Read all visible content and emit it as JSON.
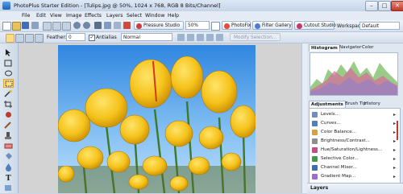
{
  "window": {
    "title": "PhotoPlus Starter Edition - [Tulips.jpg @ 50%, 1024 x 768, RGB 8 Bits/Channel]",
    "minimize": "–",
    "maximize": "□",
    "close": "✕"
  },
  "menu": [
    "File",
    "Edit",
    "View",
    "Image",
    "Effects",
    "Layers",
    "Select",
    "Window",
    "Help"
  ],
  "toolbar": {
    "pressure_studio": "Pressure Studio",
    "zoom_value": "50%",
    "photofix": "PhotoFix",
    "filter_gallery": "Filter Gallery",
    "cutout_studio": "Cutout Studio",
    "workspace_label": "Workspace",
    "workspace_value": "Default"
  },
  "context_toolbar": {
    "feather_label": "Feather:",
    "feather_value": "0",
    "antialias_label": "Antialias",
    "antialias_checked": "✓",
    "blend_value": "Normal",
    "modify_selection": "Modify Selection..."
  },
  "panels": {
    "top_tabs": [
      "Histogram",
      "Navigator",
      "Color"
    ],
    "mid_tabs": [
      "Adjustments",
      "Brush Tip",
      "History"
    ],
    "adjustments": [
      {
        "label": "Levels...",
        "color": "#6b8fbf"
      },
      {
        "label": "Curves...",
        "color": "#4d7fc1"
      },
      {
        "label": "Color Balance...",
        "color": "#d9a13b"
      },
      {
        "label": "Brightness/Contrast...",
        "color": "#8e8e8e"
      },
      {
        "label": "Hue/Saturation/Lightness...",
        "color": "#c54b8c"
      },
      {
        "label": "Selective Color...",
        "color": "#3c9c4a"
      },
      {
        "label": "Channel Mixer...",
        "color": "#3a6fb8"
      },
      {
        "label": "Gradient Map...",
        "color": "#a06ad0"
      }
    ],
    "layers_title": "Layers"
  },
  "colors": {
    "accent": "#d9a53d",
    "close_red": "#c0392b",
    "sky_top": "#2f86e0",
    "tulip": "#f5c21a"
  }
}
